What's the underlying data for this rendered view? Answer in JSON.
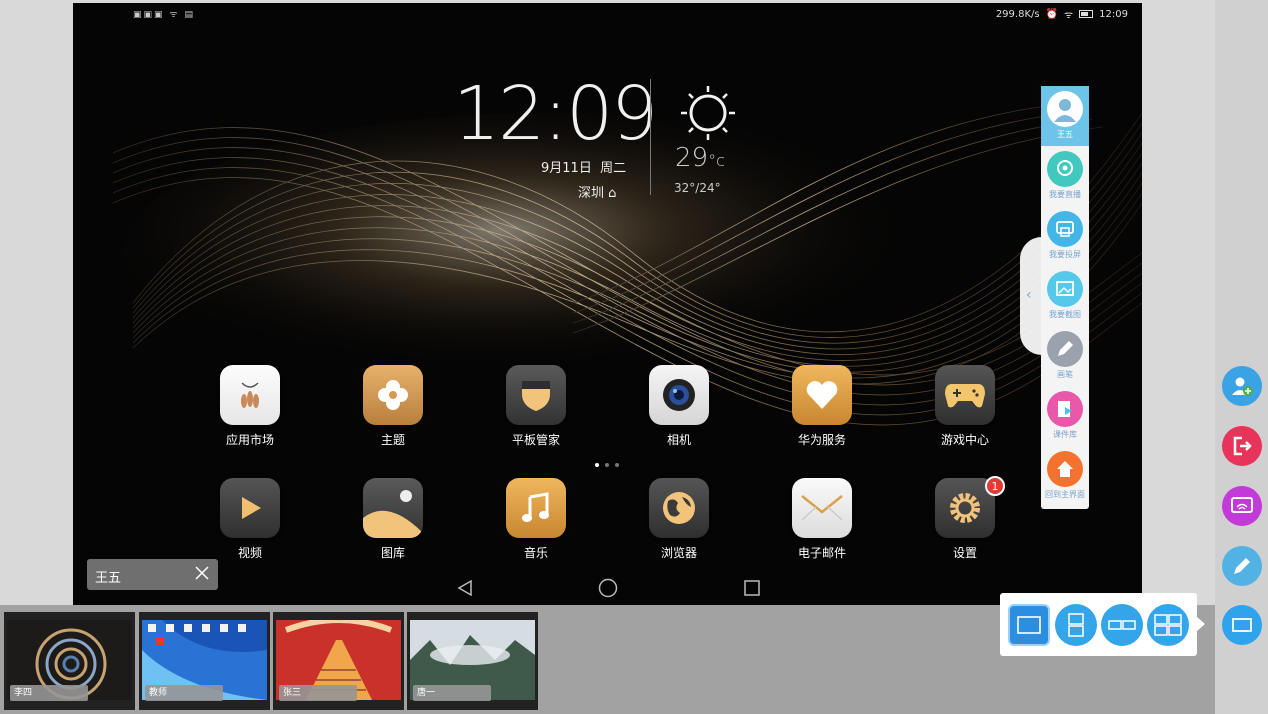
{
  "status_bar": {
    "left_icons": "▣▣▣ ᯤ ▤",
    "speed": "299.8K/s",
    "time": "12:09"
  },
  "clock": {
    "time": "12:09",
    "date": "9月11日",
    "weekday": "周二",
    "city": "深圳"
  },
  "weather": {
    "temp": "29",
    "unit": "°c",
    "range": "32°/24°",
    "icon": "sun-icon"
  },
  "apps_row1": [
    {
      "label": "应用市场",
      "icon": "app-market-icon"
    },
    {
      "label": "主题",
      "icon": "theme-icon"
    },
    {
      "label": "平板管家",
      "icon": "tablet-manager-icon"
    },
    {
      "label": "相机",
      "icon": "camera-icon"
    },
    {
      "label": "华为服务",
      "icon": "huawei-service-icon"
    },
    {
      "label": "游戏中心",
      "icon": "game-center-icon"
    }
  ],
  "apps_row2": [
    {
      "label": "视频",
      "icon": "video-icon"
    },
    {
      "label": "图库",
      "icon": "gallery-icon"
    },
    {
      "label": "音乐",
      "icon": "music-icon"
    },
    {
      "label": "浏览器",
      "icon": "browser-icon"
    },
    {
      "label": "电子邮件",
      "icon": "email-icon"
    },
    {
      "label": "设置",
      "icon": "settings-icon",
      "badge": "1"
    }
  ],
  "user_tag": {
    "name": "王五"
  },
  "side_panel": {
    "user": "王五",
    "live": "我要直播",
    "cast": "我要投屏",
    "screenshot": "我要截图",
    "pen": "画笔",
    "courseware": "课件库",
    "home": "回到主界面"
  },
  "thumbnails": [
    {
      "label": "李四"
    },
    {
      "label": "教师"
    },
    {
      "label": "张三"
    },
    {
      "label": "唐一"
    }
  ],
  "colors": {
    "accent_blue": "#33a5e8",
    "exit_red": "#e8335a",
    "cast_purple": "#c23ad8",
    "gold": "#d8a24a"
  }
}
